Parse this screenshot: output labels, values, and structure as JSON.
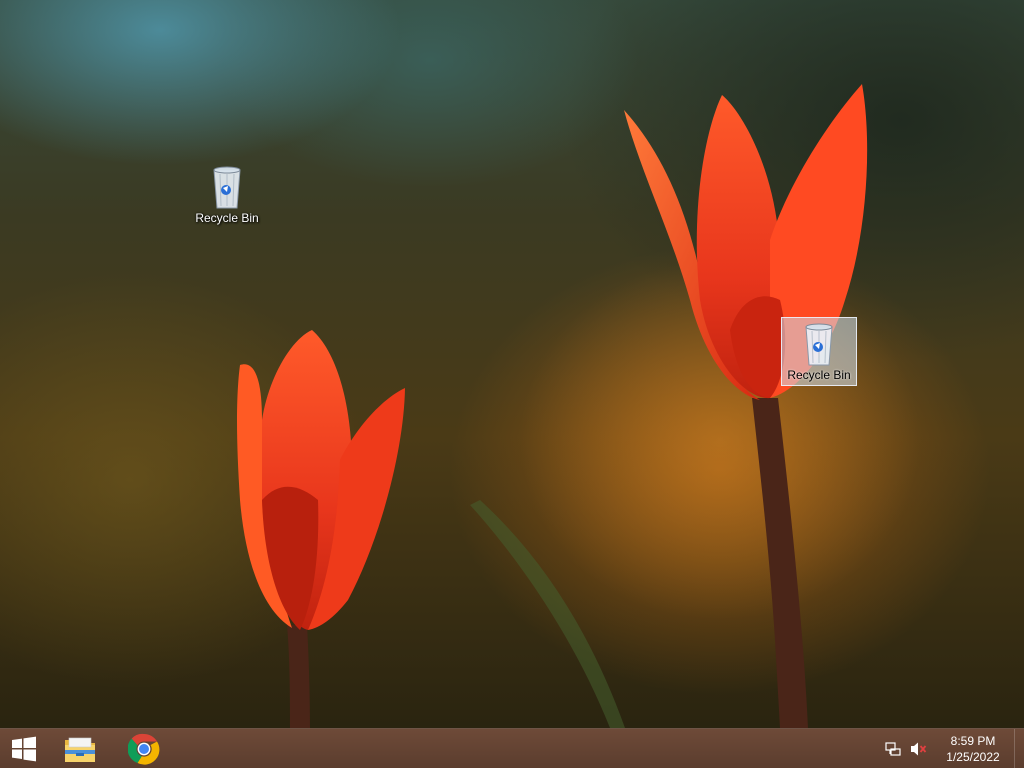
{
  "desktop": {
    "icons": [
      {
        "label": "Recycle Bin",
        "icon": "recycle-bin-icon",
        "selected": false
      },
      {
        "label": "Recycle Bin",
        "icon": "recycle-bin-icon",
        "selected": true
      }
    ]
  },
  "taskbar": {
    "start_icon": "windows-logo-icon",
    "pinned": [
      {
        "name": "File Explorer",
        "icon": "folder-icon"
      },
      {
        "name": "Google Chrome",
        "icon": "chrome-icon"
      }
    ],
    "tray": {
      "icons": [
        "network-icon",
        "volume-muted-icon"
      ],
      "time": "8:59 PM",
      "date": "1/25/2022"
    }
  },
  "colors": {
    "taskbar": "#6e4a38",
    "chrome_red": "#db4437",
    "chrome_green": "#0f9d58",
    "chrome_yellow": "#f4b400",
    "chrome_blue": "#4285f4"
  }
}
